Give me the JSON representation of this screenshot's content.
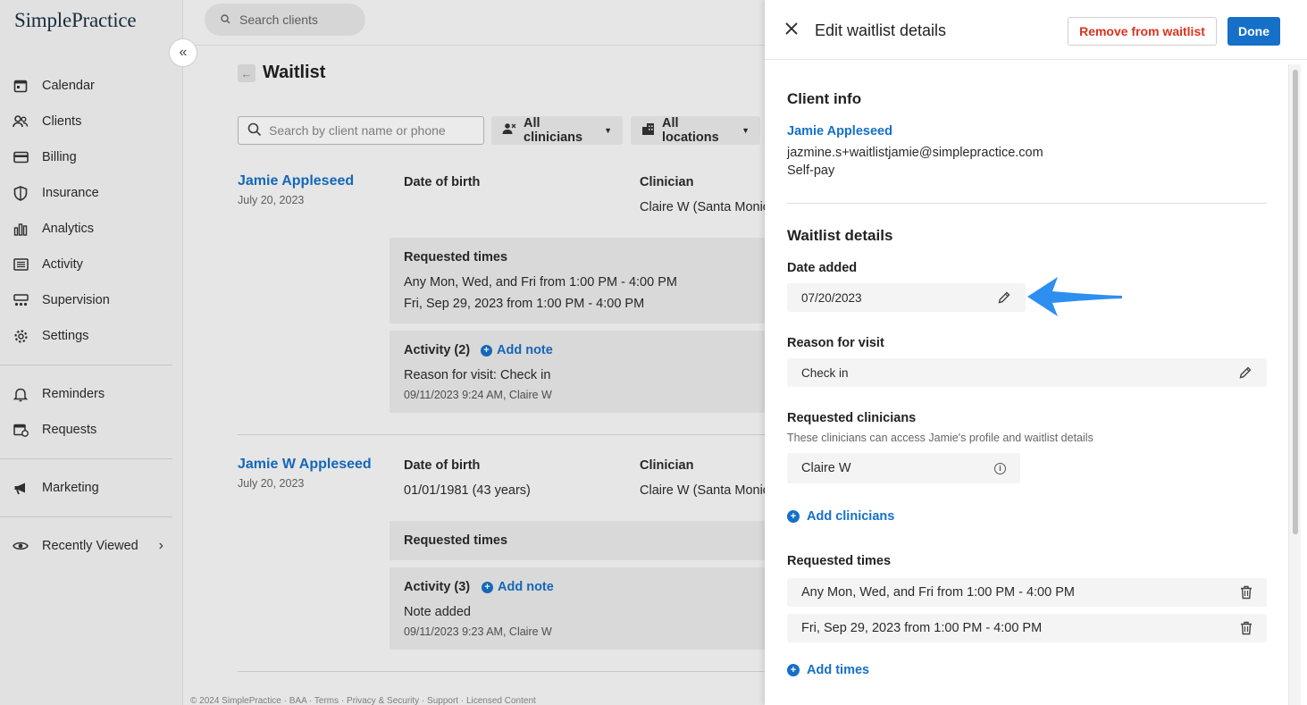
{
  "app": {
    "logo": "SimplePractice"
  },
  "topbar": {
    "search_placeholder": "Search clients"
  },
  "sidebar": {
    "items": [
      {
        "label": "Calendar",
        "icon": "calendar-icon"
      },
      {
        "label": "Clients",
        "icon": "clients-icon"
      },
      {
        "label": "Billing",
        "icon": "billing-icon"
      },
      {
        "label": "Insurance",
        "icon": "shield-icon"
      },
      {
        "label": "Analytics",
        "icon": "bar-chart-icon"
      },
      {
        "label": "Activity",
        "icon": "list-icon"
      },
      {
        "label": "Supervision",
        "icon": "supervision-icon"
      },
      {
        "label": "Settings",
        "icon": "gear-icon"
      }
    ],
    "items2": [
      {
        "label": "Reminders",
        "icon": "bell-icon"
      },
      {
        "label": "Requests",
        "icon": "requests-icon"
      }
    ],
    "marketing": {
      "label": "Marketing",
      "icon": "megaphone-icon"
    },
    "recent": {
      "label": "Recently Viewed",
      "icon": "eye-icon"
    }
  },
  "waitlist": {
    "title": "Waitlist",
    "search_placeholder": "Search by client name or phone",
    "filter_clinicians": "All clinicians",
    "filter_locations": "All locations",
    "entries": [
      {
        "name": "Jamie Appleseed",
        "date": "July 20, 2023",
        "dob_label": "Date of birth",
        "dob_value": "",
        "clinician_label": "Clinician",
        "clinician_value": "Claire W (Santa Monic",
        "requested_label": "Requested times",
        "requested": [
          "Any Mon, Wed, and Fri from 1:00 PM - 4:00 PM",
          "Fri, Sep 29, 2023 from 1:00 PM - 4:00 PM"
        ],
        "activity_label": "Activity (2)",
        "add_note": "Add note",
        "activity_text": "Reason for visit: Check in",
        "activity_meta": "09/11/2023 9:24 AM, Claire W"
      },
      {
        "name": "Jamie W Appleseed",
        "date": "July 20, 2023",
        "dob_label": "Date of birth",
        "dob_value": "01/01/1981 (43 years)",
        "clinician_label": "Clinician",
        "clinician_value": "Claire W (Santa Monic",
        "requested_label": "Requested times",
        "activity_label": "Activity (3)",
        "add_note": "Add note",
        "activity_text": "Note added",
        "activity_meta": "09/11/2023 9:23 AM, Claire W"
      }
    ],
    "footer": "© 2024 SimplePractice · BAA · Terms · Privacy & Security · Support · Licensed Content"
  },
  "panel": {
    "title": "Edit waitlist details",
    "remove_label": "Remove from waitlist",
    "done_label": "Done",
    "client_info_heading": "Client info",
    "client_name": "Jamie Appleseed",
    "client_email": "jazmine.s+waitlistjamie@simplepractice.com",
    "client_payment": "Self-pay",
    "details_heading": "Waitlist details",
    "date_added_label": "Date added",
    "date_added_value": "07/20/2023",
    "reason_label": "Reason for visit",
    "reason_value": "Check in",
    "clinicians_label": "Requested clinicians",
    "clinicians_help": "These clinicians can access Jamie's profile and waitlist details",
    "clinician_chip": "Claire W",
    "add_clinicians": "Add clinicians",
    "times_label": "Requested times",
    "times": [
      "Any Mon, Wed, and Fri from 1:00 PM - 4:00 PM",
      "Fri, Sep 29, 2023 from 1:00 PM - 4:00 PM"
    ],
    "add_times": "Add times"
  },
  "colors": {
    "accent": "#1670c8",
    "danger": "#d9331f",
    "annotation": "#2d8ff0"
  }
}
